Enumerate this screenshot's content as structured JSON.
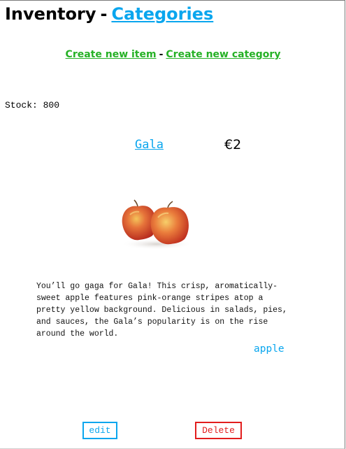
{
  "header": {
    "title": "Inventory",
    "separator": "-",
    "categories_link": "Categories"
  },
  "nav": {
    "create_item": "Create new item",
    "separator": "-",
    "create_category": "Create new category"
  },
  "item": {
    "stock_text": "Stock: 800",
    "name": "Gala",
    "price": "€2",
    "image_icon": "apple-photo",
    "description": "You’ll go gaga for Gala! This crisp, aromatically-sweet apple features pink-orange stripes atop a pretty yellow background. Delicious in salads, pies, and sauces, the Gala’s popularity is on the rise around the world.",
    "category": "apple"
  },
  "actions": {
    "edit_label": "edit",
    "delete_label": "Delete"
  },
  "colors": {
    "link_blue": "#0aa6ee",
    "link_green": "#26b126",
    "delete_red": "#e21d1d"
  }
}
